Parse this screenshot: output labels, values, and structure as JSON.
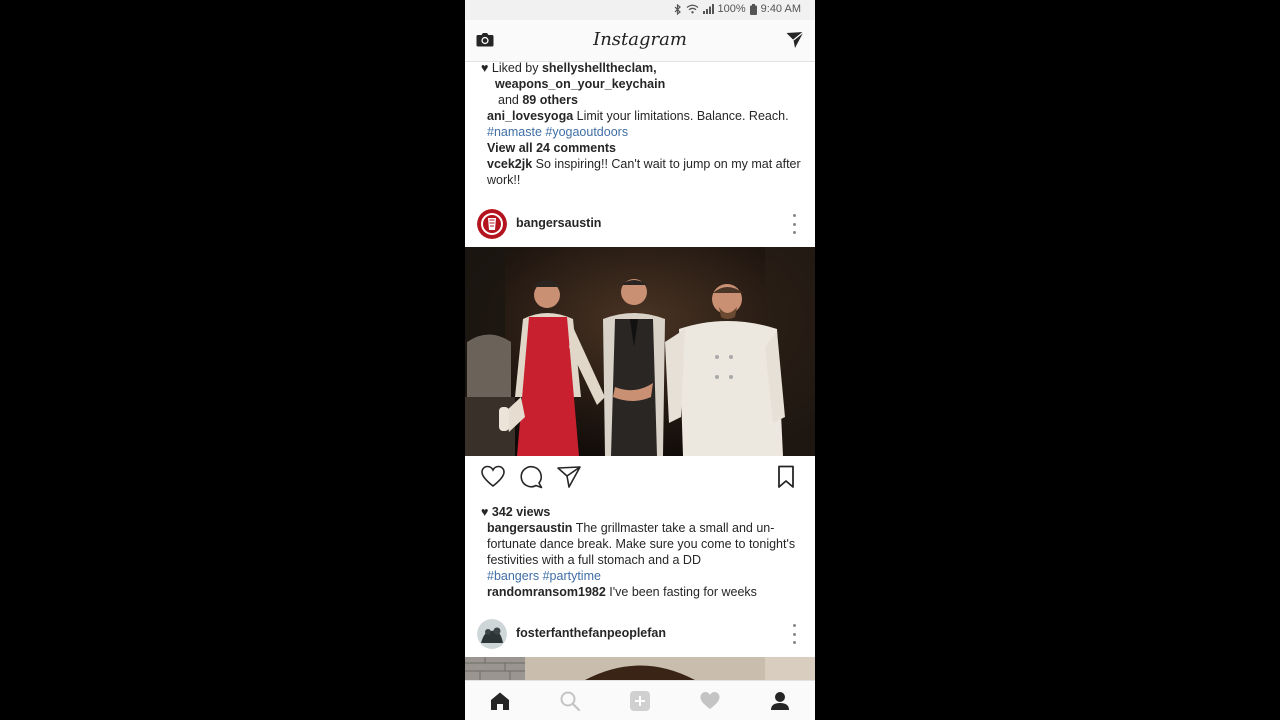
{
  "status_bar": {
    "battery": "100%",
    "time": "9:40 AM"
  },
  "app_bar": {
    "title": "Instagram"
  },
  "previous_post": {
    "liked_by_prefix": "Liked by",
    "liked_by_user1": "shellyshelltheclam,",
    "liked_by_user2": "weapons_on_your_keychain",
    "and_text": "and",
    "others_text": "89 others",
    "caption_user": "ani_lovesyoga",
    "caption_text": "Limit your limitations. Balance. Reach.",
    "caption_tags": "#namaste #yogaoutdoors",
    "view_all_comments": "View all 24 comments",
    "comment_user": "vcek2jk",
    "comment_text": "So inspiring!! Can't wait to jump on my mat after work!!"
  },
  "post": {
    "username": "bangersaustin",
    "views": "342 views",
    "caption_user": "bangersaustin",
    "caption_text": "The grillmaster take a small and un-fortunate dance break. Make sure you come to tonight's festivities with a full stomach and a DD",
    "caption_tags": "#bangers #partytime",
    "comment_user": "randomransom1982",
    "comment_text": "I've been fasting for weeks"
  },
  "next_post": {
    "username": "fosterfanthefanpeoplefan"
  },
  "icons": {
    "camera": "camera-icon",
    "direct": "direct-message-icon",
    "like": "heart-outline-icon",
    "comment": "comment-icon",
    "share": "paper-plane-icon",
    "save": "bookmark-icon",
    "home": "home-icon",
    "search": "search-icon",
    "add": "add-post-icon",
    "activity": "heart-icon",
    "profile": "profile-icon"
  },
  "colors": {
    "hashtag": "#3f6ea6",
    "text": "#262626",
    "brand_avatar": "#b4141e"
  }
}
